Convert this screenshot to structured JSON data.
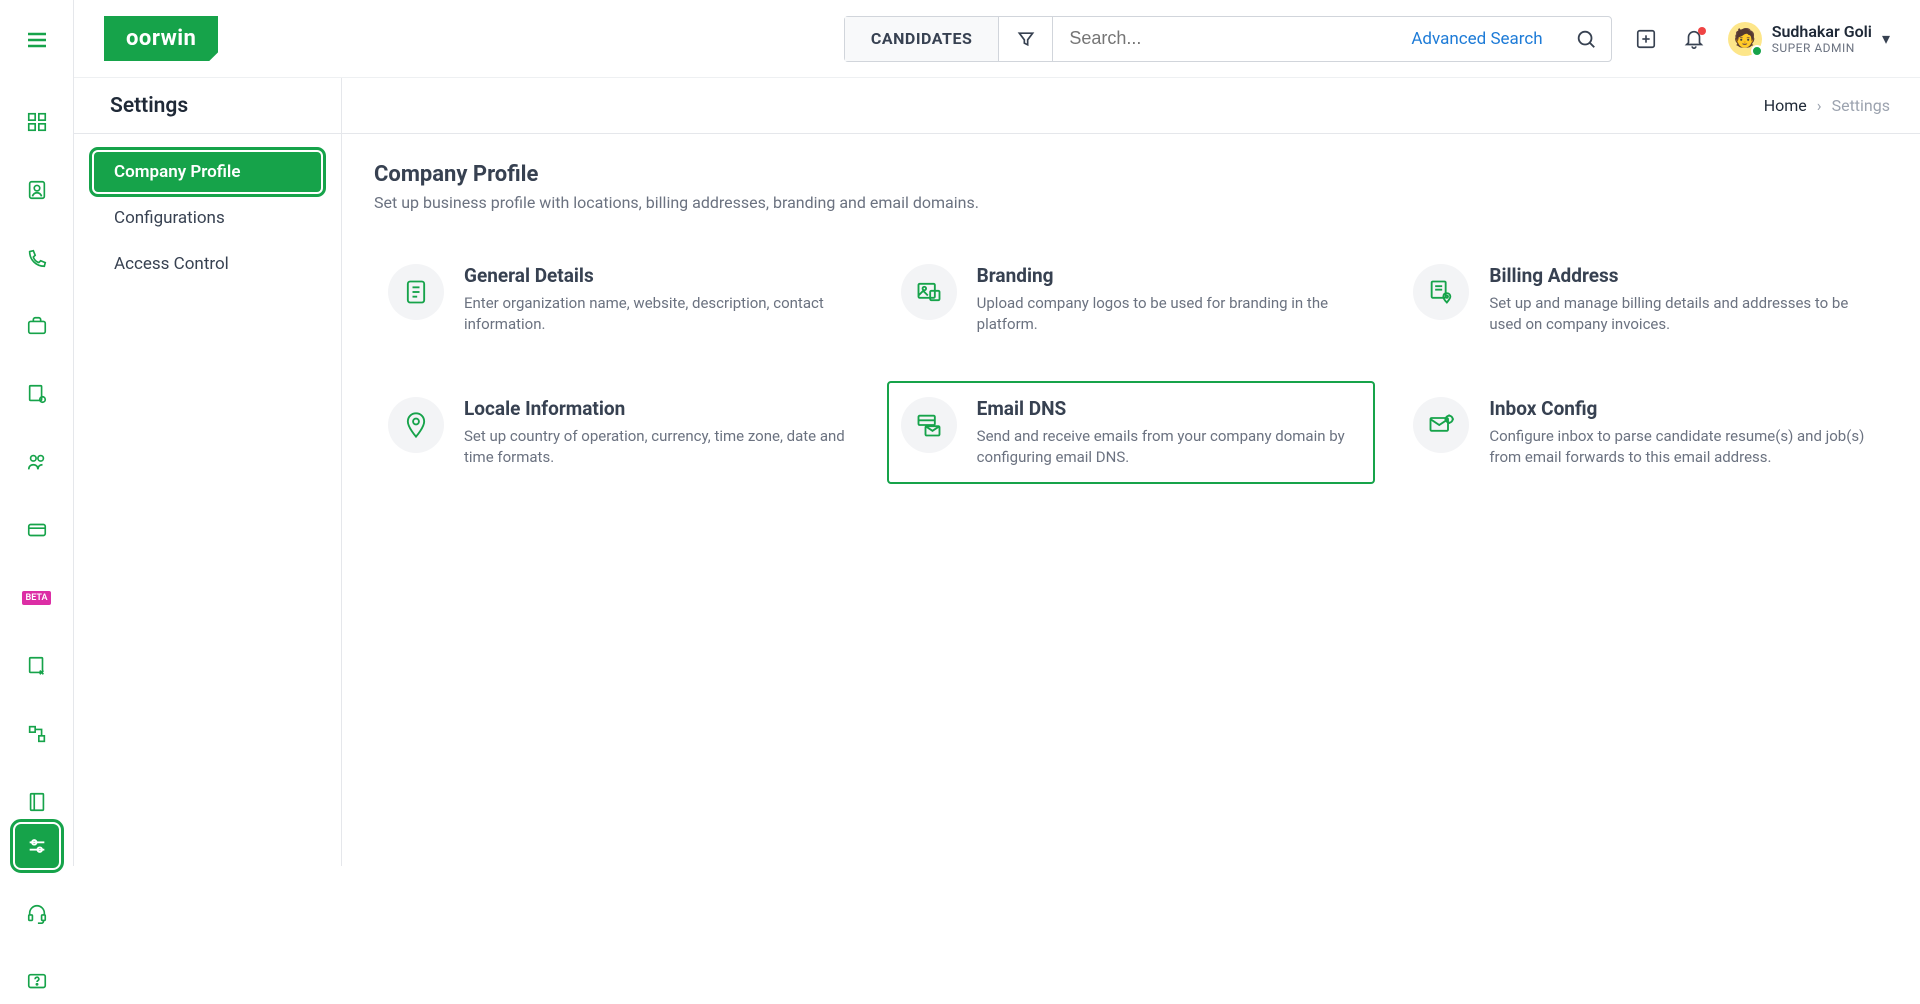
{
  "logo_text": "oorwin",
  "search": {
    "scope": "CANDIDATES",
    "placeholder": "Search...",
    "advanced": "Advanced Search"
  },
  "user": {
    "name": "Sudhakar Goli",
    "role": "SUPER ADMIN"
  },
  "settings_title": "Settings",
  "breadcrumb": {
    "home": "Home",
    "current": "Settings"
  },
  "subnav": {
    "items": [
      {
        "label": "Company Profile",
        "active": true
      },
      {
        "label": "Configurations",
        "active": false
      },
      {
        "label": "Access Control",
        "active": false
      }
    ]
  },
  "page": {
    "title": "Company Profile",
    "subtitle": "Set up business profile with locations, billing addresses, branding and email domains."
  },
  "tiles": [
    {
      "key": "general-details",
      "title": "General Details",
      "desc": "Enter organization name, website, description, contact information.",
      "highlight": false
    },
    {
      "key": "branding",
      "title": "Branding",
      "desc": "Upload company logos to be used for branding in the platform.",
      "highlight": false
    },
    {
      "key": "billing-address",
      "title": "Billing Address",
      "desc": "Set up and manage billing details and addresses to be used on company invoices.",
      "highlight": false
    },
    {
      "key": "locale-information",
      "title": "Locale Information",
      "desc": "Set up country of operation, currency, time zone, date and time formats.",
      "highlight": false
    },
    {
      "key": "email-dns",
      "title": "Email DNS",
      "desc": "Send and receive emails from your company domain by configuring email DNS.",
      "highlight": true
    },
    {
      "key": "inbox-config",
      "title": "Inbox Config",
      "desc": "Configure inbox to parse candidate resume(s) and job(s) from email forwards to this email address.",
      "highlight": false
    }
  ],
  "rail_beta": "BETA"
}
